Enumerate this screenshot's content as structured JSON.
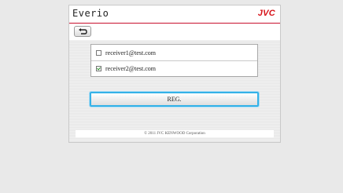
{
  "header": {
    "brand_left": "Everio",
    "brand_right": "JVC"
  },
  "toolbar": {
    "back_icon": "back-arrow-icon"
  },
  "recipients": [
    {
      "email": "receiver1@test.com",
      "checked": false
    },
    {
      "email": "receiver2@test.com",
      "checked": true
    }
  ],
  "actions": {
    "reg_label": "REG."
  },
  "footer": {
    "copyright": "© 2011 JVC KENWOOD Corporation"
  },
  "colors": {
    "accent": "#d7141a",
    "focus": "#35b2e8"
  }
}
